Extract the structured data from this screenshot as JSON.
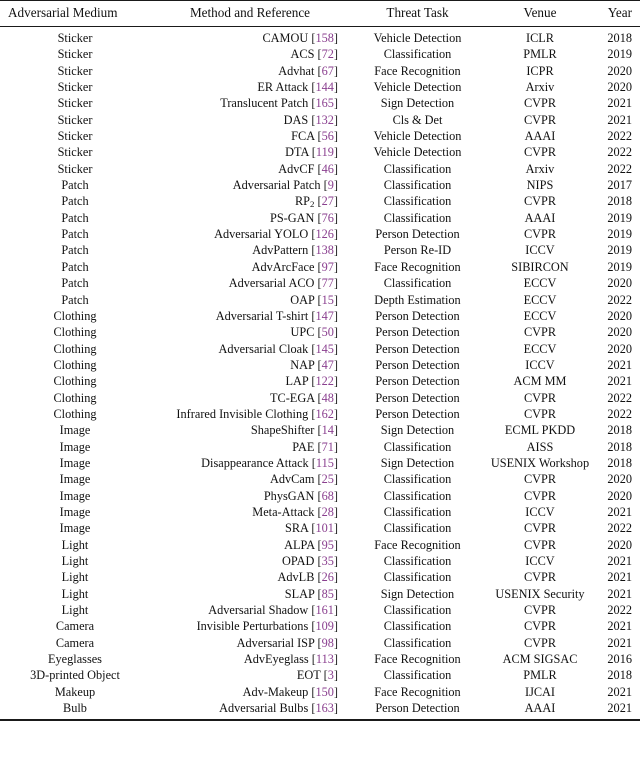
{
  "table": {
    "caption_visible": false,
    "accent_citation_color": "#8a3f8f",
    "rule_color": "#1a1a1a",
    "columns": [
      {
        "key": "medium",
        "label": "Adversarial Medium",
        "align": "center",
        "header_align": "left"
      },
      {
        "key": "method",
        "label": "Method and Reference",
        "align": "right",
        "header_align": "center"
      },
      {
        "key": "task",
        "label": "Threat Task",
        "align": "center",
        "header_align": "center"
      },
      {
        "key": "venue",
        "label": "Venue",
        "align": "center",
        "header_align": "center"
      },
      {
        "key": "year",
        "label": "Year",
        "align": "right",
        "header_align": "right"
      }
    ],
    "rows": [
      {
        "medium": "Sticker",
        "method": "CAMOU",
        "ref": "158",
        "task": "Vehicle Detection",
        "venue": "ICLR",
        "year": "2018"
      },
      {
        "medium": "Sticker",
        "method": "ACS",
        "ref": "72",
        "task": "Classification",
        "venue": "PMLR",
        "year": "2019"
      },
      {
        "medium": "Sticker",
        "method": "Advhat",
        "ref": "67",
        "task": "Face Recognition",
        "venue": "ICPR",
        "year": "2020"
      },
      {
        "medium": "Sticker",
        "method": "ER Attack",
        "ref": "144",
        "task": "Vehicle Detection",
        "venue": "Arxiv",
        "year": "2020"
      },
      {
        "medium": "Sticker",
        "method": "Translucent Patch",
        "ref": "165",
        "task": "Sign Detection",
        "venue": "CVPR",
        "year": "2021"
      },
      {
        "medium": "Sticker",
        "method": "DAS",
        "ref": "132",
        "task": "Cls & Det",
        "venue": "CVPR",
        "year": "2021"
      },
      {
        "medium": "Sticker",
        "method": "FCA",
        "ref": "56",
        "task": "Vehicle Detection",
        "venue": "AAAI",
        "year": "2022"
      },
      {
        "medium": "Sticker",
        "method": "DTA",
        "ref": "119",
        "task": "Vehicle Detection",
        "venue": "CVPR",
        "year": "2022"
      },
      {
        "medium": "Sticker",
        "method": "AdvCF",
        "ref": "46",
        "task": "Classification",
        "venue": "Arxiv",
        "year": "2022"
      },
      {
        "medium": "Patch",
        "method": "Adversarial Patch",
        "ref": "9",
        "task": "Classification",
        "venue": "NIPS",
        "year": "2017"
      },
      {
        "medium": "Patch",
        "method": "RP<sub>2</sub>",
        "ref": "27",
        "task": "Classification",
        "venue": "CVPR",
        "year": "2018",
        "method_html": true
      },
      {
        "medium": "Patch",
        "method": "PS-GAN",
        "ref": "76",
        "task": "Classification",
        "venue": "AAAI",
        "year": "2019"
      },
      {
        "medium": "Patch",
        "method": "Adversarial YOLO",
        "ref": "126",
        "task": "Person Detection",
        "venue": "CVPR",
        "year": "2019"
      },
      {
        "medium": "Patch",
        "method": "AdvPattern",
        "ref": "138",
        "task": "Person Re-ID",
        "venue": "ICCV",
        "year": "2019"
      },
      {
        "medium": "Patch",
        "method": "AdvArcFace",
        "ref": "97",
        "task": "Face Recognition",
        "venue": "SIBIRCON",
        "year": "2019"
      },
      {
        "medium": "Patch",
        "method": "Adversarial ACO",
        "ref": "77",
        "task": "Classification",
        "venue": "ECCV",
        "year": "2020"
      },
      {
        "medium": "Patch",
        "method": "OAP",
        "ref": "15",
        "task": "Depth Estimation",
        "venue": "ECCV",
        "year": "2022"
      },
      {
        "medium": "Clothing",
        "method": "Adversarial T-shirt",
        "ref": "147",
        "task": "Person Detection",
        "venue": "ECCV",
        "year": "2020"
      },
      {
        "medium": "Clothing",
        "method": "UPC",
        "ref": "50",
        "task": "Person Detection",
        "venue": "CVPR",
        "year": "2020"
      },
      {
        "medium": "Clothing",
        "method": "Adversarial Cloak",
        "ref": "145",
        "task": "Person Detection",
        "venue": "ECCV",
        "year": "2020"
      },
      {
        "medium": "Clothing",
        "method": "NAP",
        "ref": "47",
        "task": "Person Detection",
        "venue": "ICCV",
        "year": "2021"
      },
      {
        "medium": "Clothing",
        "method": "LAP",
        "ref": "122",
        "task": "Person Detection",
        "venue": "ACM MM",
        "year": "2021"
      },
      {
        "medium": "Clothing",
        "method": "TC-EGA",
        "ref": "48",
        "task": "Person Detection",
        "venue": "CVPR",
        "year": "2022"
      },
      {
        "medium": "Clothing",
        "method": "Infrared Invisible Clothing",
        "ref": "162",
        "task": "Person Detection",
        "venue": "CVPR",
        "year": "2022"
      },
      {
        "medium": "Image",
        "method": "ShapeShifter",
        "ref": "14",
        "task": "Sign Detection",
        "venue": "ECML PKDD",
        "year": "2018"
      },
      {
        "medium": "Image",
        "method": "PAE",
        "ref": "71",
        "task": "Classification",
        "venue": "AISS",
        "year": "2018"
      },
      {
        "medium": "Image",
        "method": "Disappearance Attack",
        "ref": "115",
        "task": "Sign Detection",
        "venue": "USENIX Workshop",
        "year": "2018"
      },
      {
        "medium": "Image",
        "method": "AdvCam",
        "ref": "25",
        "task": "Classification",
        "venue": "CVPR",
        "year": "2020"
      },
      {
        "medium": "Image",
        "method": "PhysGAN",
        "ref": "68",
        "task": "Classification",
        "venue": "CVPR",
        "year": "2020"
      },
      {
        "medium": "Image",
        "method": "Meta-Attack",
        "ref": "28",
        "task": "Classification",
        "venue": "ICCV",
        "year": "2021"
      },
      {
        "medium": "Image",
        "method": "SRA",
        "ref": "101",
        "task": "Classification",
        "venue": "CVPR",
        "year": "2022"
      },
      {
        "medium": "Light",
        "method": "ALPA",
        "ref": "95",
        "task": "Face Recognition",
        "venue": "CVPR",
        "year": "2020"
      },
      {
        "medium": "Light",
        "method": "OPAD",
        "ref": "35",
        "task": "Classification",
        "venue": "ICCV",
        "year": "2021"
      },
      {
        "medium": "Light",
        "method": "AdvLB",
        "ref": "26",
        "task": "Classification",
        "venue": "CVPR",
        "year": "2021"
      },
      {
        "medium": "Light",
        "method": "SLAP",
        "ref": "85",
        "task": "Sign Detection",
        "venue": "USENIX Security",
        "year": "2021"
      },
      {
        "medium": "Light",
        "method": "Adversarial Shadow",
        "ref": "161",
        "task": "Classification",
        "venue": "CVPR",
        "year": "2022"
      },
      {
        "medium": "Camera",
        "method": "Invisible Perturbations",
        "ref": "109",
        "task": "Classification",
        "venue": "CVPR",
        "year": "2021"
      },
      {
        "medium": "Camera",
        "method": "Adversarial ISP",
        "ref": "98",
        "task": "Classification",
        "venue": "CVPR",
        "year": "2021"
      },
      {
        "medium": "Eyeglasses",
        "method": "AdvEyeglass",
        "ref": "113",
        "task": "Face Recognition",
        "venue": "ACM SIGSAC",
        "year": "2016"
      },
      {
        "medium": "3D-printed Object",
        "method": "EOT",
        "ref": "3",
        "task": "Classification",
        "venue": "PMLR",
        "year": "2018"
      },
      {
        "medium": "Makeup",
        "method": "Adv-Makeup",
        "ref": "150",
        "task": "Face Recognition",
        "venue": "IJCAI",
        "year": "2021"
      },
      {
        "medium": "Bulb",
        "method": "Adversarial Bulbs",
        "ref": "163",
        "task": "Person Detection",
        "venue": "AAAI",
        "year": "2021"
      }
    ]
  }
}
